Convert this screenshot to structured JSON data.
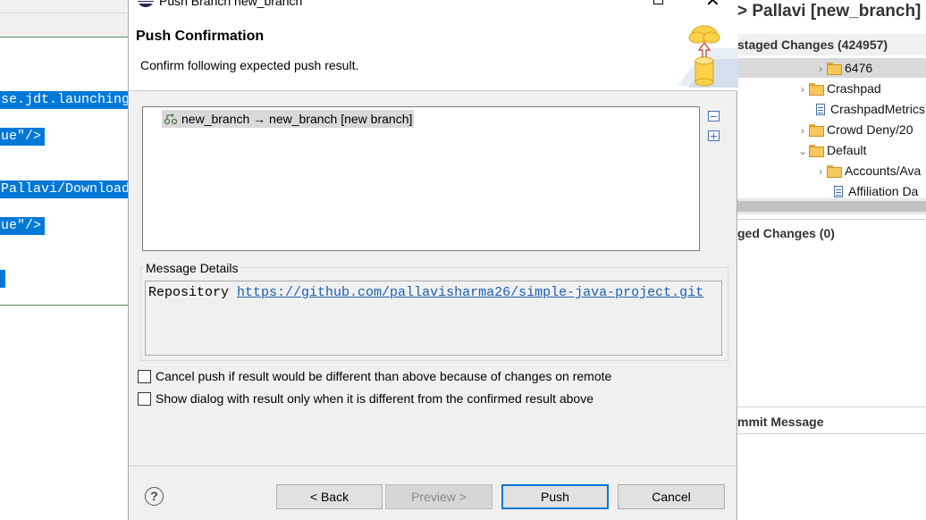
{
  "editor": {
    "code_lines": [
      "se.jdt.launching",
      "ue\"/>",
      "Pallavi/Download",
      "ue\"/>",
      ""
    ]
  },
  "staging": {
    "title": "> Pallavi [new_branch]",
    "unstaged_label": "staged Changes (424957)",
    "tree": [
      {
        "label": "6476",
        "type": "folder",
        "expanded": false,
        "selected": true
      },
      {
        "label": "Crashpad",
        "type": "folder",
        "expanded": false
      },
      {
        "label": "CrashpadMetrics",
        "type": "file"
      },
      {
        "label": "Crowd Deny/20",
        "type": "folder",
        "expanded": false
      },
      {
        "label": "Default",
        "type": "folder",
        "expanded": true
      },
      {
        "label": "Accounts/Ava",
        "type": "folder",
        "expanded": false
      },
      {
        "label": "Affiliation Da",
        "type": "file"
      }
    ],
    "staged_label": "ged Changes (0)",
    "commit_label": "mmit Message"
  },
  "dialog": {
    "window_title": "Push Branch new_branch",
    "heading": "Push Confirmation",
    "description": "Confirm following expected push result.",
    "result_entry": "new_branch → new_branch [new branch]",
    "message_details_label": "Message Details",
    "repository_label": "Repository",
    "repository_url": "https://github.com/pallavisharma26/simple-java-project.git",
    "options": [
      {
        "label": "Cancel push if result would be different than above because of changes on remote",
        "checked": false
      },
      {
        "label": "Show dialog with result only when it is different from the confirmed result above",
        "checked": false
      }
    ],
    "buttons": {
      "back": "< Back",
      "preview": "Preview >",
      "push": "Push",
      "cancel": "Cancel"
    },
    "help_glyph": "?"
  },
  "colors": {
    "selection_blue": "#0078d7",
    "link": "#1a5fb4",
    "dialog_bg": "#f0f0f0"
  }
}
